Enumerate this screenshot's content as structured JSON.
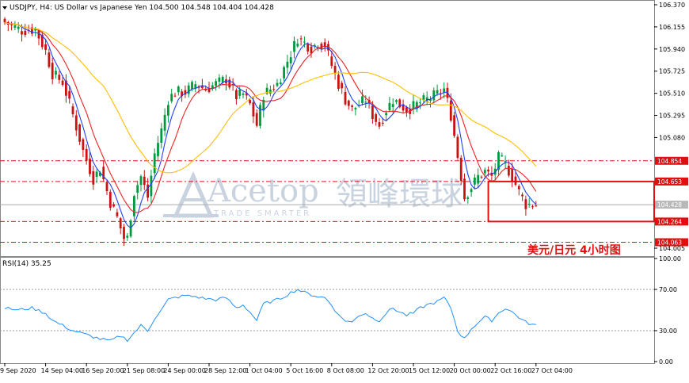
{
  "header": {
    "symbol_line": "USDJPY, H4:  US Dollar vs Japanese Yen  104.500 104.548 104.404 104.428",
    "rsi_label": "RSI(14) 35.25"
  },
  "watermark": {
    "brand_latin": "Acetop",
    "brand_cjk": "領峰環球",
    "tagline": "TRADE SMARTER"
  },
  "caption": "美元/日元   4小时图",
  "colors": {
    "bull": "#009a3e",
    "bear": "#cc1111",
    "ma_fast": "#1e40ff",
    "ma_mid": "#ee2222",
    "ma_slow": "#ffbf00",
    "rsi": "#1e90ff",
    "level": "#e01010",
    "box": "#e01010",
    "current": "#aaaaaa",
    "current_tag": "#b8b8b8"
  },
  "chart_data": {
    "type": "candlestick",
    "price_axis": {
      "range": [
        104.005,
        106.37
      ],
      "ticks": [
        "106.370",
        "106.155",
        "105.940",
        "105.725",
        "105.510",
        "105.295",
        "105.080",
        "104.005"
      ],
      "tick_values": [
        106.37,
        106.155,
        105.94,
        105.725,
        105.51,
        105.295,
        105.08,
        104.005
      ]
    },
    "current_price": {
      "value": 104.428,
      "label": "104.428"
    },
    "levels": [
      {
        "value": 104.854,
        "label": "104.854"
      },
      {
        "value": 104.653,
        "label": "104.653"
      },
      {
        "value": 104.264,
        "label": "104.264"
      },
      {
        "value": 104.063,
        "label": "104.063"
      }
    ],
    "highlight_box": {
      "bar_start": 142,
      "bar_end": 160,
      "price_top": 104.653,
      "price_bottom": 104.264
    },
    "time_axis": {
      "labels": [
        "9 Sep 2020",
        "14 Sep 04:00",
        "16 Sep 20:00",
        "21 Sep 08:00",
        "24 Sep 00:00",
        "28 Sep 12:00",
        "1 Oct 04:00",
        "5 Oct 16:00",
        "8 Oct 08:00",
        "12 Oct 20:00",
        "15 Oct 12:00",
        "20 Oct 00:00",
        "22 Oct 16:00",
        "27 Oct 04:00"
      ],
      "label_bars": [
        0,
        12,
        24,
        36,
        48,
        60,
        72,
        84,
        96,
        108,
        120,
        132,
        144,
        156
      ]
    },
    "bar_count": 157,
    "key_points": [
      [
        0,
        106.2
      ],
      [
        5,
        106.12
      ],
      [
        9,
        106.13
      ],
      [
        12,
        105.92
      ],
      [
        14,
        105.7
      ],
      [
        17,
        105.62
      ],
      [
        20,
        105.3
      ],
      [
        23,
        104.95
      ],
      [
        26,
        104.68
      ],
      [
        28,
        104.78
      ],
      [
        31,
        104.45
      ],
      [
        33,
        104.3
      ],
      [
        35,
        104.1
      ],
      [
        36,
        104.1
      ],
      [
        38,
        104.55
      ],
      [
        40,
        104.7
      ],
      [
        42,
        104.5
      ],
      [
        44,
        104.92
      ],
      [
        46,
        105.15
      ],
      [
        48,
        105.45
      ],
      [
        50,
        105.52
      ],
      [
        53,
        105.52
      ],
      [
        56,
        105.6
      ],
      [
        59,
        105.55
      ],
      [
        62,
        105.6
      ],
      [
        65,
        105.65
      ],
      [
        68,
        105.48
      ],
      [
        70,
        105.5
      ],
      [
        72,
        105.4
      ],
      [
        74,
        105.2
      ],
      [
        76,
        105.5
      ],
      [
        78,
        105.55
      ],
      [
        80,
        105.6
      ],
      [
        82,
        105.75
      ],
      [
        84,
        105.9
      ],
      [
        86,
        106.05
      ],
      [
        88,
        106.0
      ],
      [
        90,
        105.95
      ],
      [
        92,
        106.0
      ],
      [
        94,
        105.98
      ],
      [
        96,
        105.78
      ],
      [
        98,
        105.6
      ],
      [
        100,
        105.45
      ],
      [
        102,
        105.35
      ],
      [
        104,
        105.4
      ],
      [
        106,
        105.45
      ],
      [
        108,
        105.3
      ],
      [
        110,
        105.2
      ],
      [
        112,
        105.35
      ],
      [
        114,
        105.45
      ],
      [
        116,
        105.4
      ],
      [
        118,
        105.35
      ],
      [
        120,
        105.38
      ],
      [
        122,
        105.42
      ],
      [
        124,
        105.45
      ],
      [
        127,
        105.5
      ],
      [
        129,
        105.55
      ],
      [
        131,
        105.3
      ],
      [
        133,
        104.9
      ],
      [
        135,
        104.5
      ],
      [
        137,
        104.6
      ],
      [
        139,
        104.7
      ],
      [
        141,
        104.75
      ],
      [
        143,
        104.7
      ],
      [
        145,
        104.88
      ],
      [
        147,
        104.82
      ],
      [
        149,
        104.7
      ],
      [
        151,
        104.55
      ],
      [
        153,
        104.43
      ],
      [
        156,
        104.43
      ]
    ],
    "rsi": {
      "label": "RSI(14) 35.25",
      "axis_ticks": [
        "100.00",
        "70.00",
        "30.00",
        "0.00"
      ],
      "tick_values": [
        100,
        70,
        30,
        0
      ],
      "range": [
        0,
        100
      ],
      "key_points": [
        [
          0,
          52
        ],
        [
          4,
          50
        ],
        [
          8,
          52
        ],
        [
          12,
          47
        ],
        [
          14,
          40
        ],
        [
          17,
          35
        ],
        [
          20,
          30
        ],
        [
          23,
          27
        ],
        [
          26,
          24
        ],
        [
          28,
          22
        ],
        [
          31,
          20
        ],
        [
          34,
          25
        ],
        [
          36,
          21
        ],
        [
          38,
          28
        ],
        [
          40,
          35
        ],
        [
          42,
          30
        ],
        [
          44,
          42
        ],
        [
          46,
          50
        ],
        [
          48,
          60
        ],
        [
          50,
          62
        ],
        [
          53,
          64
        ],
        [
          56,
          63
        ],
        [
          59,
          61
        ],
        [
          62,
          60
        ],
        [
          65,
          62
        ],
        [
          68,
          52
        ],
        [
          70,
          55
        ],
        [
          72,
          48
        ],
        [
          74,
          40
        ],
        [
          76,
          56
        ],
        [
          78,
          58
        ],
        [
          80,
          60
        ],
        [
          82,
          63
        ],
        [
          84,
          67
        ],
        [
          86,
          70
        ],
        [
          88,
          67
        ],
        [
          90,
          65
        ],
        [
          92,
          63
        ],
        [
          94,
          62
        ],
        [
          96,
          55
        ],
        [
          98,
          45
        ],
        [
          100,
          40
        ],
        [
          102,
          38
        ],
        [
          104,
          45
        ],
        [
          106,
          47
        ],
        [
          108,
          42
        ],
        [
          110,
          40
        ],
        [
          112,
          47
        ],
        [
          114,
          52
        ],
        [
          116,
          48
        ],
        [
          118,
          45
        ],
        [
          120,
          47
        ],
        [
          122,
          52
        ],
        [
          124,
          55
        ],
        [
          127,
          58
        ],
        [
          129,
          62
        ],
        [
          131,
          52
        ],
        [
          133,
          30
        ],
        [
          135,
          22
        ],
        [
          137,
          32
        ],
        [
          139,
          38
        ],
        [
          141,
          43
        ],
        [
          143,
          40
        ],
        [
          145,
          47
        ],
        [
          147,
          52
        ],
        [
          149,
          48
        ],
        [
          151,
          43
        ],
        [
          153,
          38
        ],
        [
          156,
          35
        ]
      ]
    }
  }
}
